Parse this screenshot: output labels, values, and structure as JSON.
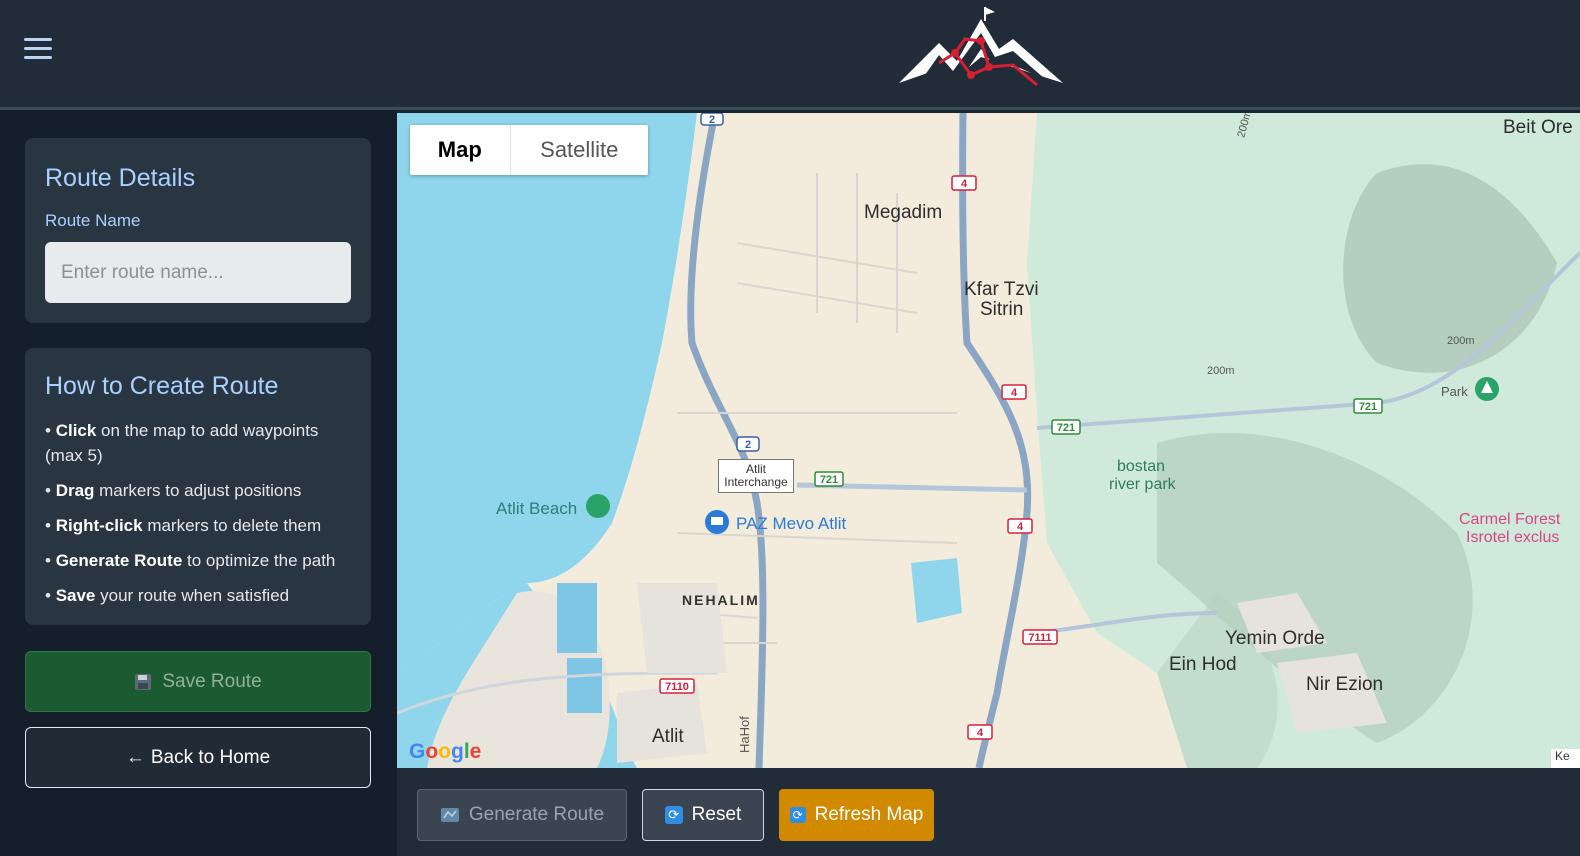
{
  "header": {
    "menu_icon": "hamburger-icon",
    "logo_icon": "mountain-logo-icon"
  },
  "sidebar": {
    "route_details": {
      "title": "Route Details",
      "route_name_label": "Route Name",
      "route_name_placeholder": "Enter route name...",
      "route_name_value": ""
    },
    "how_to": {
      "title": "How to Create Route",
      "items": [
        {
          "bold": "Click",
          "rest": " on the map to add waypoints (max 5)"
        },
        {
          "bold": "Drag",
          "rest": " markers to adjust positions"
        },
        {
          "bold": "Right-click",
          "rest": " markers to delete them"
        },
        {
          "bold": "Generate Route",
          "rest": " to optimize the path"
        },
        {
          "bold": "Save",
          "rest": " your route when satisfied"
        }
      ]
    },
    "save_button": {
      "icon": "floppy-disk-icon",
      "label": "Save Route"
    },
    "home_button": {
      "arrow": "←",
      "label": "Back to Home"
    }
  },
  "map": {
    "type_toggle": {
      "map": "Map",
      "satellite": "Satellite",
      "selected": "Map"
    },
    "places": {
      "megadim": "Megadim",
      "kfar_tzvi_1": "Kfar Tzvi",
      "kfar_tzvi_2": "Sitrin",
      "beit_oren": "Beit Ore",
      "atlit_beach": "Atlit Beach",
      "paz": "PAZ Mevo Atlit",
      "nehalim": "NEHALIM",
      "atlit": "Atlit",
      "bostan_1": "bostan",
      "bostan_2": "river park",
      "park": "Park",
      "carmel_1": "Carmel Forest",
      "carmel_2": "Isrotel exclus",
      "yemin_orde": "Yemin Orde",
      "ein_hod": "Ein Hod",
      "nir_ezion": "Nir Ezion",
      "hahof": "HaHof",
      "interchange_1": "Atlit",
      "interchange_2": "Interchange",
      "contour_200a": "200m",
      "contour_200b": "200m",
      "contour_200c": "200m"
    },
    "shields": {
      "r2_top": "2",
      "r2_mid": "2",
      "r4_a": "4",
      "r4_b": "4",
      "r4_c": "4",
      "r4_d": "4",
      "r721_a": "721",
      "r721_b": "721",
      "r721_c": "721",
      "r7111": "7111",
      "r7110": "7110"
    },
    "google": [
      "G",
      "o",
      "o",
      "g",
      "l",
      "e"
    ],
    "attribution": "Ke",
    "colors": {
      "water": "#8fd6ec",
      "land": "#f3ecdc",
      "forest": "#cfeadb",
      "highway": "#8ba6c4",
      "shield_red": "#d4213d",
      "shield_green": "#2e8b3a"
    }
  },
  "toolbar": {
    "generate": {
      "icon": "map-icon",
      "label": "Generate Route"
    },
    "reset": {
      "icon": "refresh-icon",
      "label": "Reset"
    },
    "refresh": {
      "icon": "refresh-icon",
      "label": "Refresh Map"
    }
  }
}
